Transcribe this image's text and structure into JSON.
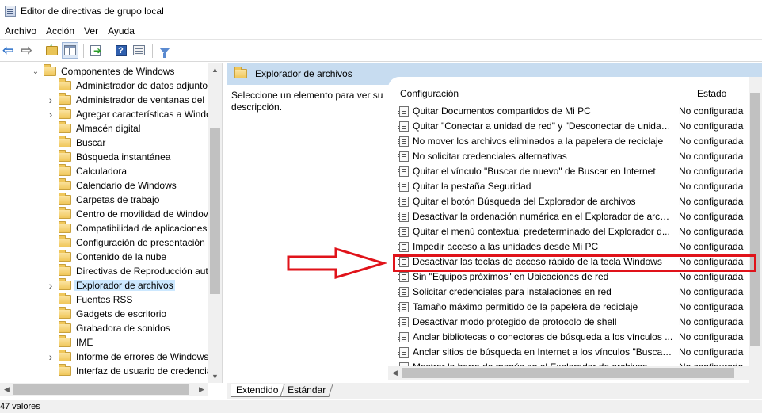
{
  "window": {
    "title": "Editor de directivas de grupo local"
  },
  "menu": [
    "Archivo",
    "Acción",
    "Ver",
    "Ayuda"
  ],
  "tree": {
    "items": [
      {
        "label": "Componentes de Windows",
        "depth": 0,
        "expanded": true
      },
      {
        "label": "Administrador de datos adjunto",
        "depth": 1
      },
      {
        "label": "Administrador de ventanas del",
        "depth": 1,
        "expandable": true
      },
      {
        "label": "Agregar características a Windo",
        "depth": 1,
        "expandable": true
      },
      {
        "label": "Almacén digital",
        "depth": 1
      },
      {
        "label": "Buscar",
        "depth": 1
      },
      {
        "label": "Búsqueda instantánea",
        "depth": 1
      },
      {
        "label": "Calculadora",
        "depth": 1
      },
      {
        "label": "Calendario de Windows",
        "depth": 1
      },
      {
        "label": "Carpetas de trabajo",
        "depth": 1
      },
      {
        "label": "Centro de movilidad de Windov",
        "depth": 1
      },
      {
        "label": "Compatibilidad de aplicaciones",
        "depth": 1
      },
      {
        "label": "Configuración de presentación",
        "depth": 1
      },
      {
        "label": "Contenido de la nube",
        "depth": 1
      },
      {
        "label": "Directivas de Reproducción aut",
        "depth": 1
      },
      {
        "label": "Explorador de archivos",
        "depth": 1,
        "expandable": true,
        "selected": true
      },
      {
        "label": "Fuentes RSS",
        "depth": 1
      },
      {
        "label": "Gadgets de escritorio",
        "depth": 1
      },
      {
        "label": "Grabadora de sonidos",
        "depth": 1
      },
      {
        "label": "IME",
        "depth": 1
      },
      {
        "label": "Informe de errores de Windows",
        "depth": 1,
        "expandable": true
      },
      {
        "label": "Interfaz de usuario de credencia",
        "depth": 1
      }
    ]
  },
  "right": {
    "header_title": "Explorador de archivos",
    "description": "Seleccione un elemento para ver su descripción.",
    "columns": {
      "config": "Configuración",
      "state": "Estado"
    },
    "rows": [
      {
        "name": "Quitar Documentos compartidos de Mi PC",
        "state": "No configurada"
      },
      {
        "name": "Quitar \"Conectar a unidad de red\" y \"Desconectar de unidad...",
        "state": "No configurada"
      },
      {
        "name": "No mover los archivos eliminados a la papelera de reciclaje",
        "state": "No configurada"
      },
      {
        "name": "No solicitar credenciales alternativas",
        "state": "No configurada"
      },
      {
        "name": "Quitar el vínculo \"Buscar de nuevo\" de Buscar en Internet",
        "state": "No configurada"
      },
      {
        "name": "Quitar la pestaña Seguridad",
        "state": "No configurada"
      },
      {
        "name": "Quitar el botón Búsqueda del Explorador de archivos",
        "state": "No configurada"
      },
      {
        "name": "Desactivar la ordenación numérica en el Explorador de archi...",
        "state": "No configurada"
      },
      {
        "name": "Quitar el menú contextual predeterminado del Explorador d...",
        "state": "No configurada"
      },
      {
        "name": "Impedir acceso a las unidades desde Mi PC",
        "state": "No configurada"
      },
      {
        "name": "Desactivar las teclas de acceso rápido de la tecla Windows",
        "state": "No configurada",
        "highlighted": true
      },
      {
        "name": "Sin \"Equipos próximos\" en Ubicaciones de red",
        "state": "No configurada"
      },
      {
        "name": "Solicitar credenciales para instalaciones en red",
        "state": "No configurada"
      },
      {
        "name": "Tamaño máximo permitido de la papelera de reciclaje",
        "state": "No configurada"
      },
      {
        "name": "Desactivar modo protegido de protocolo de shell",
        "state": "No configurada"
      },
      {
        "name": "Anclar bibliotecas o conectores de búsqueda a los vínculos ...",
        "state": "No configurada"
      },
      {
        "name": "Anclar sitios de búsqueda en Internet a los vínculos \"Buscar ...",
        "state": "No configurada"
      },
      {
        "name": "Mostrar la barra de menús en el Explorador de archivos",
        "state": "No configurada"
      }
    ]
  },
  "tabs": [
    "Extendido",
    "Estándar"
  ],
  "status": "47 valores",
  "colors": {
    "header_bg": "#c7dcf0",
    "selection": "#cce8ff",
    "annotation": "#e0131a"
  }
}
